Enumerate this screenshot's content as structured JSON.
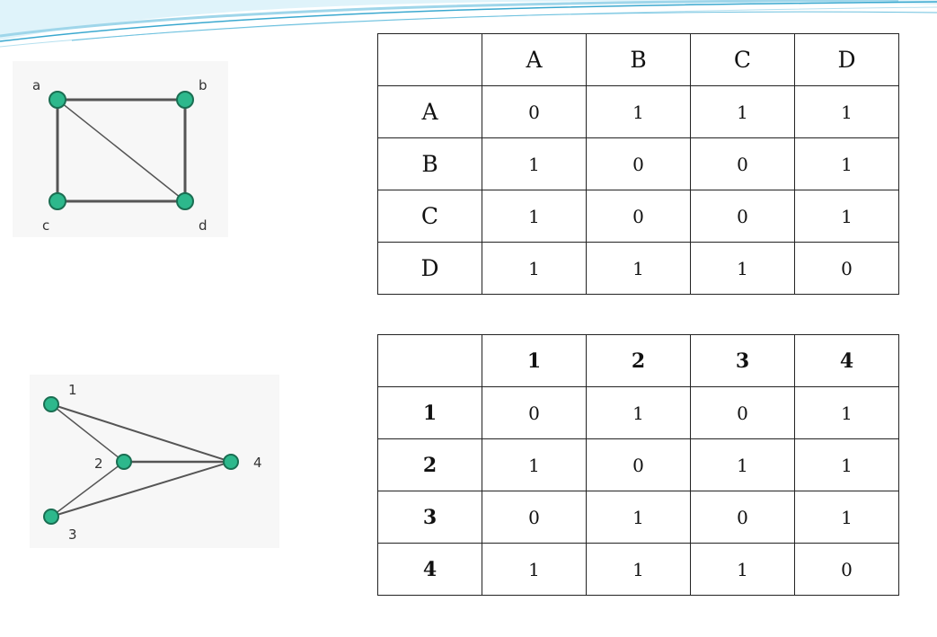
{
  "graph1": {
    "nodes": [
      "a",
      "b",
      "c",
      "d"
    ],
    "edges": [
      [
        "a",
        "b"
      ],
      [
        "a",
        "c"
      ],
      [
        "a",
        "d"
      ],
      [
        "b",
        "d"
      ],
      [
        "c",
        "d"
      ]
    ]
  },
  "graph2": {
    "nodes": [
      "1",
      "2",
      "3",
      "4"
    ],
    "edges": [
      [
        "1",
        "2"
      ],
      [
        "1",
        "4"
      ],
      [
        "2",
        "3"
      ],
      [
        "2",
        "4"
      ],
      [
        "3",
        "4"
      ]
    ]
  },
  "table1": {
    "corner": "",
    "cols": [
      "A",
      "B",
      "C",
      "D"
    ],
    "rows": [
      {
        "label": "A",
        "cells": [
          "0",
          "1",
          "1",
          "1"
        ]
      },
      {
        "label": "B",
        "cells": [
          "1",
          "0",
          "0",
          "1"
        ]
      },
      {
        "label": "C",
        "cells": [
          "1",
          "0",
          "0",
          "1"
        ]
      },
      {
        "label": "D",
        "cells": [
          "1",
          "1",
          "1",
          "0"
        ]
      }
    ]
  },
  "table2": {
    "corner": "",
    "cols": [
      "1",
      "2",
      "3",
      "4"
    ],
    "rows": [
      {
        "label": "1",
        "cells": [
          "0",
          "1",
          "0",
          "1"
        ]
      },
      {
        "label": "2",
        "cells": [
          "1",
          "0",
          "1",
          "1"
        ]
      },
      {
        "label": "3",
        "cells": [
          "0",
          "1",
          "0",
          "1"
        ]
      },
      {
        "label": "4",
        "cells": [
          "1",
          "1",
          "1",
          "0"
        ]
      }
    ]
  },
  "colors": {
    "node_fill": "#2db88c",
    "node_stroke": "#1a6e52",
    "edge": "#555555",
    "swoosh_light": "#c7e9f5",
    "swoosh_dark": "#3aa8cf"
  }
}
